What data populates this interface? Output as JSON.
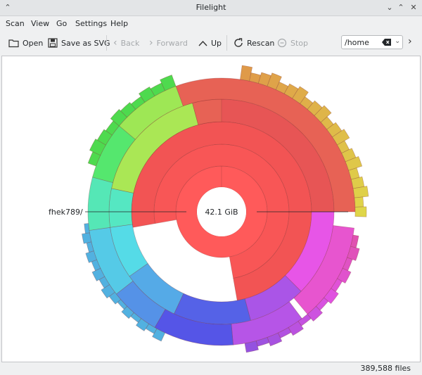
{
  "window": {
    "title": "Filelight"
  },
  "menu": [
    "Scan",
    "View",
    "Go",
    "Settings",
    "Help"
  ],
  "toolbar": {
    "open": "Open",
    "save_svg": "Save as SVG",
    "back": "Back",
    "forward": "Forward",
    "up": "Up",
    "rescan": "Rescan",
    "stop": "Stop"
  },
  "location": {
    "value": "/home"
  },
  "chart": {
    "center_label": "42.1 GiB",
    "hover_label": "fhek789/"
  },
  "status": {
    "files": "389,588 files"
  },
  "colors": {
    "accent": "#3daee9",
    "root_red": "#ff5a5a"
  }
}
